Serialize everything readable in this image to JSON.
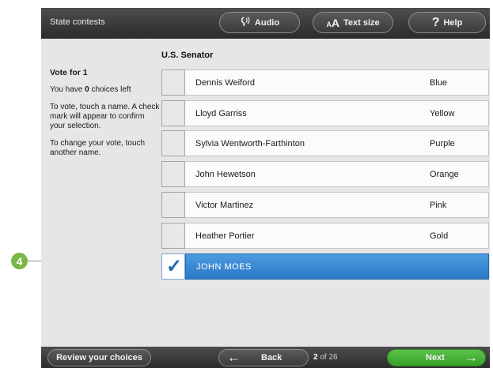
{
  "header": {
    "title": "State contests",
    "audio_label": "Audio",
    "textsize_prefix": "AA",
    "textsize_label": "Text size",
    "help_label": "Help"
  },
  "instructions": {
    "vote_for": "Vote for 1",
    "choices_prefix": "You have",
    "choices_count": "0",
    "choices_suffix": "choices left",
    "touch_text": "To vote, touch a name. A check mark will appear to confirm your selection.",
    "change_text": "To change your vote, touch another name."
  },
  "contest": {
    "office": "U.S. Senator",
    "candidates": [
      {
        "name": "Dennis Weiford",
        "party": "Blue",
        "selected": false
      },
      {
        "name": "Lloyd Garriss",
        "party": "Yellow",
        "selected": false
      },
      {
        "name": "Sylvia Wentworth-Farthinton",
        "party": "Purple",
        "selected": false
      },
      {
        "name": "John Hewetson",
        "party": "Orange",
        "selected": false
      },
      {
        "name": "Victor Martinez",
        "party": "Pink",
        "selected": false
      },
      {
        "name": "Heather Portier",
        "party": "Gold",
        "selected": false
      },
      {
        "name": "JOHN MOES",
        "party": "",
        "selected": true
      }
    ]
  },
  "footer": {
    "review_label": "Review your choices",
    "back_label": "Back",
    "page_current": "2",
    "page_of": "of 26",
    "next_label": "Next"
  },
  "annotation": {
    "callout_number": "4"
  },
  "colors": {
    "selected_blue": "#2b78c5",
    "next_green": "#4bb23a",
    "callout_green": "#7ab648",
    "bar_dark": "#3a3a3a"
  }
}
